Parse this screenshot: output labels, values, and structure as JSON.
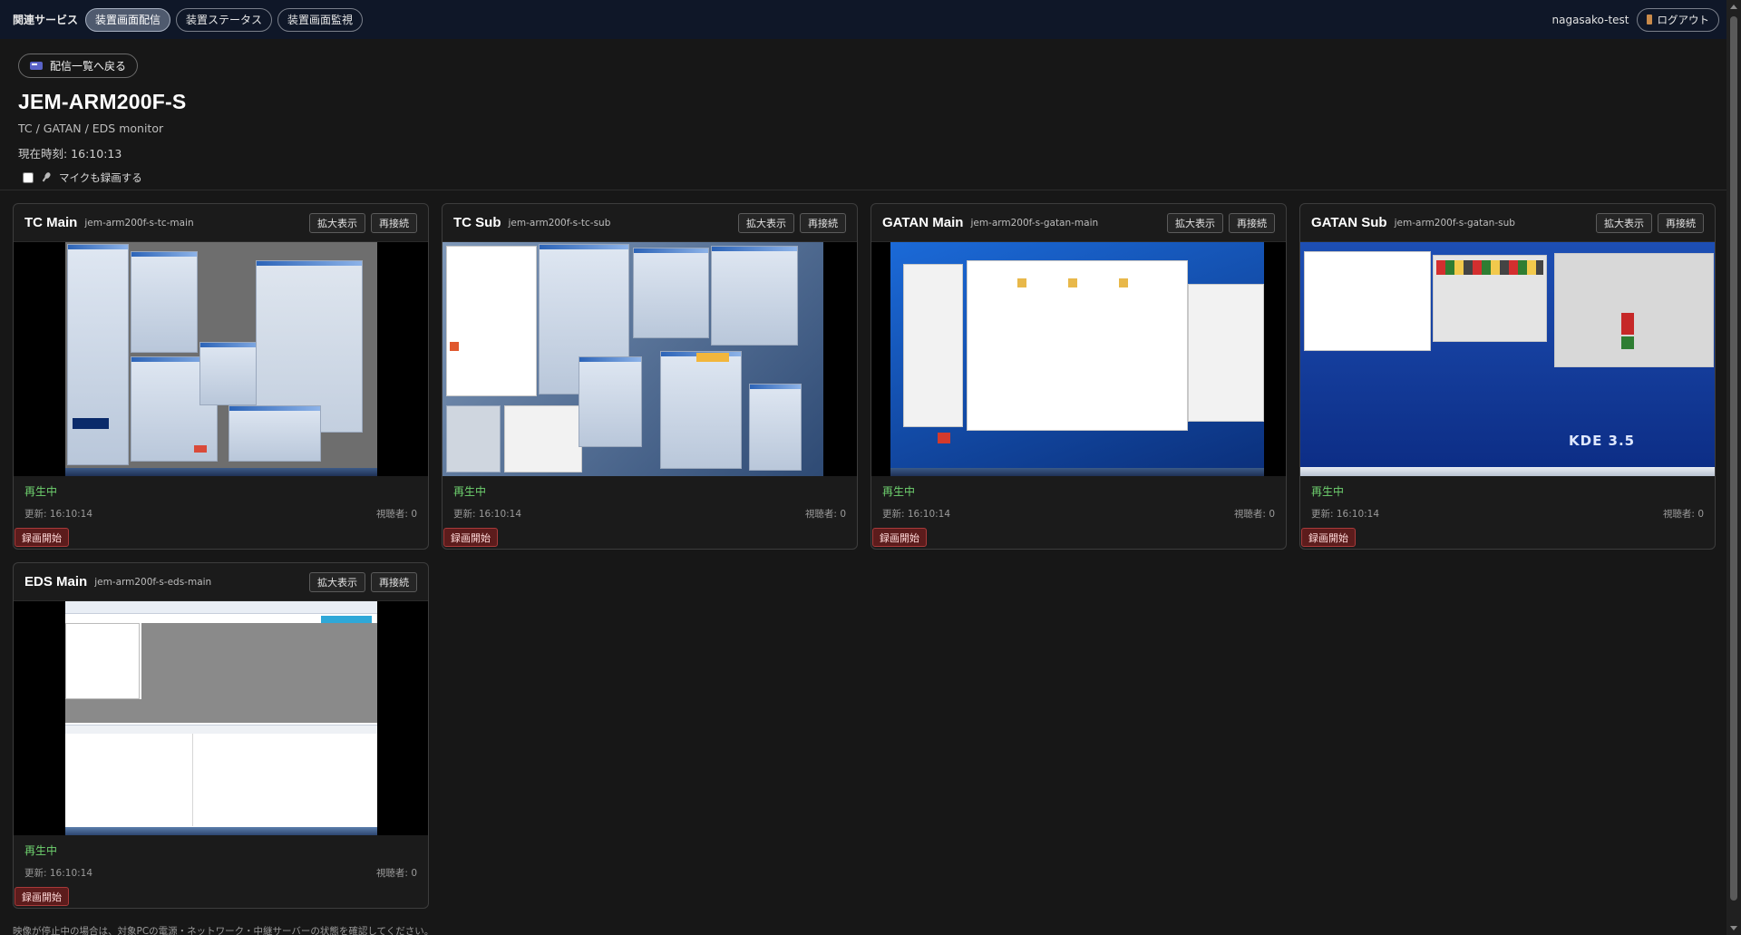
{
  "topbar": {
    "service_label": "関連サービス",
    "nav": [
      {
        "label": "装置画面配信",
        "active": true
      },
      {
        "label": "装置ステータス",
        "active": false
      },
      {
        "label": "装置画面監視",
        "active": false
      }
    ],
    "user": "nagasako-test",
    "logout_label": "ログアウト"
  },
  "header": {
    "back_label": "配信一覧へ戻る",
    "title": "JEM-ARM200F-S",
    "subtitle": "TC / GATAN / EDS monitor",
    "clock": "現在時刻: 16:10:13",
    "mic_label": "マイクも録画する",
    "mic_checked": false
  },
  "streams": [
    {
      "name": "TC Main",
      "id": "jem-arm200f-s-tc-main",
      "status": "再生中",
      "updated": "更新: 16:10:14",
      "viewers": "視聴者: 0"
    },
    {
      "name": "TC Sub",
      "id": "jem-arm200f-s-tc-sub",
      "status": "再生中",
      "updated": "更新: 16:10:14",
      "viewers": "視聴者: 0"
    },
    {
      "name": "GATAN Main",
      "id": "jem-arm200f-s-gatan-main",
      "status": "再生中",
      "updated": "更新: 16:10:14",
      "viewers": "視聴者: 0"
    },
    {
      "name": "GATAN Sub",
      "id": "jem-arm200f-s-gatan-sub",
      "status": "再生中",
      "updated": "更新: 16:10:14",
      "viewers": "視聴者: 0",
      "screen_text": "KDE 3.5"
    },
    {
      "name": "EDS Main",
      "id": "jem-arm200f-s-eds-main",
      "status": "再生中",
      "updated": "更新: 16:10:14",
      "viewers": "視聴者: 0"
    }
  ],
  "card_buttons": {
    "expand": "拡大表示",
    "reconnect": "再接続",
    "record": "録画開始"
  },
  "footnote": "映像が停止中の場合は、対象PCの電源・ネットワーク・中継サーバーの状態を確認してください。",
  "colors": {
    "playing": "#6fd36f",
    "record_bg": "#5c1c1c",
    "topbar_bg": "#0f1728"
  }
}
